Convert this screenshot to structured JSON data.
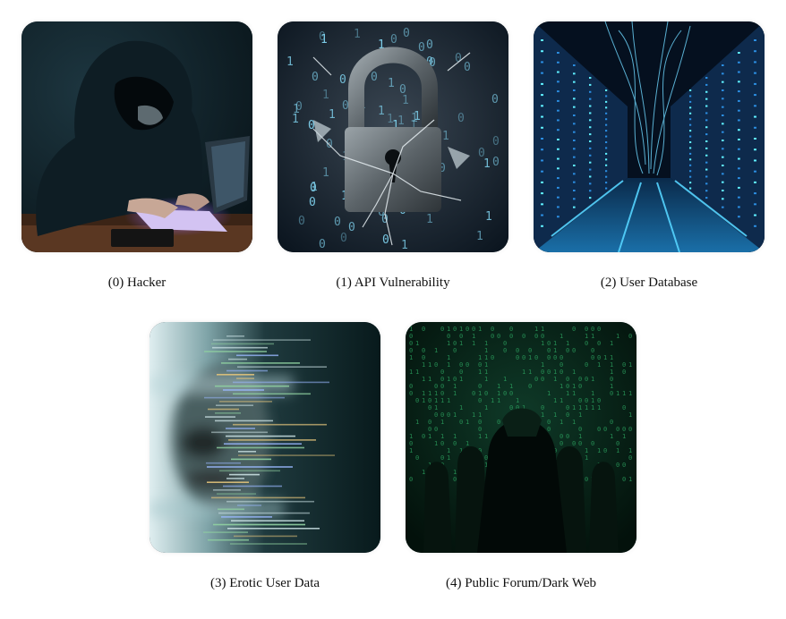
{
  "panels": [
    {
      "caption": "(0) Hacker",
      "image": "hooded-hacker-with-laptop"
    },
    {
      "caption": "(1) API Vulnerability",
      "image": "broken-padlock-binary"
    },
    {
      "caption": "(2) User Database",
      "image": "server-room-corridor"
    },
    {
      "caption": "(3) Erotic User Data",
      "image": "blurred-face-with-code"
    },
    {
      "caption": "(4) Public Forum/Dark Web",
      "image": "hooded-figures-matrix"
    }
  ],
  "binary_digits": [
    "0",
    "1"
  ]
}
